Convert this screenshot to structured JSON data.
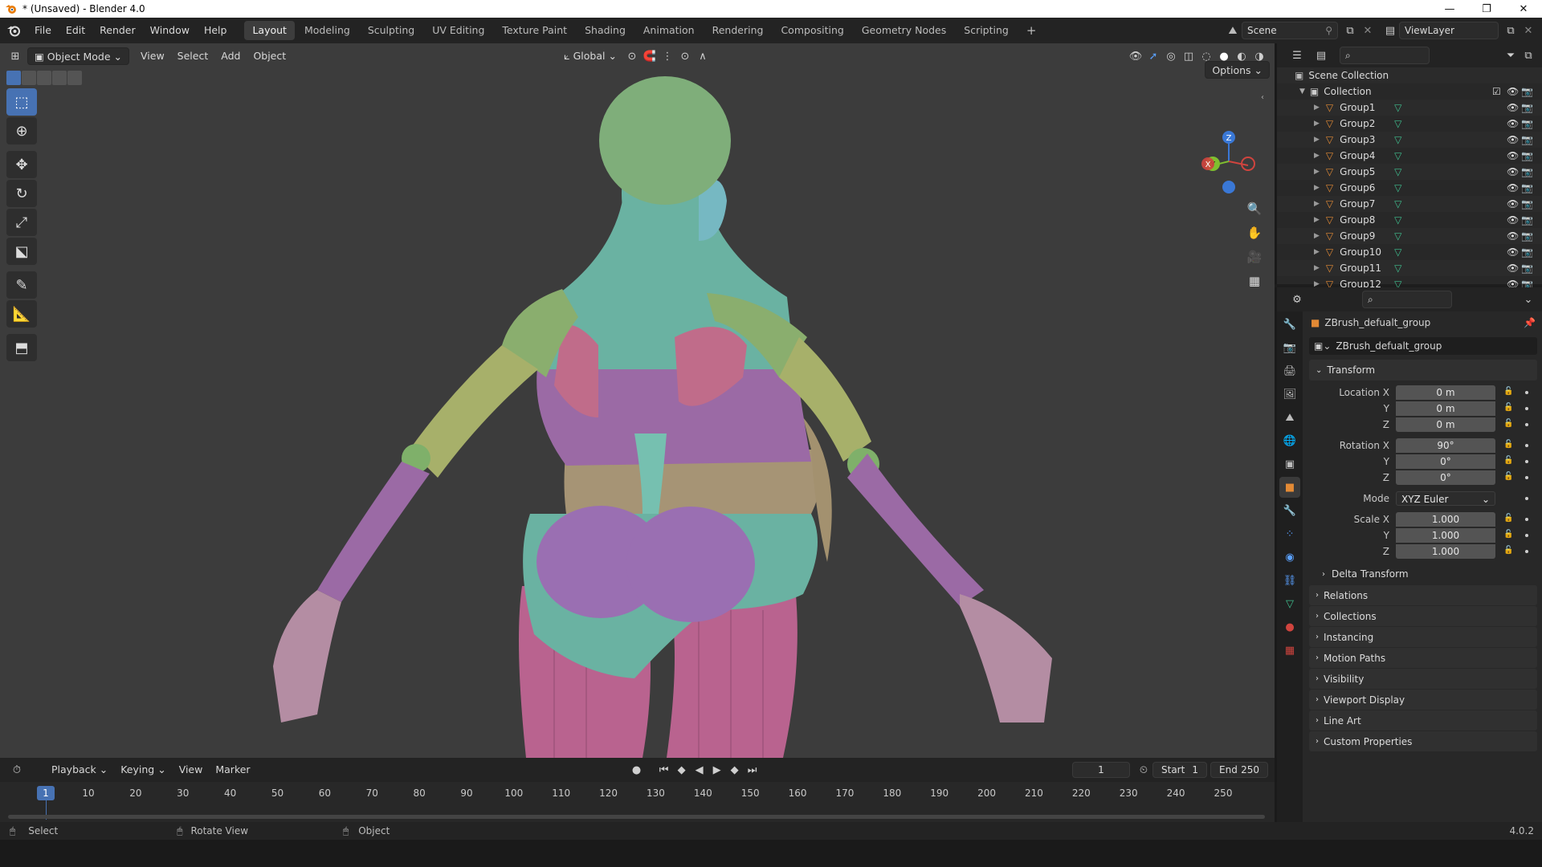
{
  "window": {
    "title": "* (Unsaved) - Blender 4.0",
    "controls": [
      "—",
      "❐",
      "✕"
    ]
  },
  "menu": {
    "items": [
      "File",
      "Edit",
      "Render",
      "Window",
      "Help"
    ],
    "workspaces": [
      "Layout",
      "Modeling",
      "Sculpting",
      "UV Editing",
      "Texture Paint",
      "Shading",
      "Animation",
      "Rendering",
      "Compositing",
      "Geometry Nodes",
      "Scripting"
    ],
    "active_workspace": "Layout",
    "add_workspace": "+",
    "scene": "Scene",
    "view_layer": "ViewLayer"
  },
  "viewport": {
    "mode": "Object Mode",
    "menus": [
      "View",
      "Select",
      "Add",
      "Object"
    ],
    "orientation": "Global",
    "options": "Options",
    "gizmo_axes": {
      "x": "X",
      "y": "Y",
      "z": "Z"
    }
  },
  "timeline": {
    "menus": [
      "Playback",
      "Keying",
      "View",
      "Marker"
    ],
    "current_frame": "1",
    "start_label": "Start",
    "start": "1",
    "end_label": "End",
    "end": "250",
    "ticks": [
      "10",
      "20",
      "30",
      "40",
      "50",
      "60",
      "70",
      "80",
      "90",
      "100",
      "110",
      "120",
      "130",
      "140",
      "150",
      "160",
      "170",
      "180",
      "190",
      "200",
      "210",
      "220",
      "230",
      "240",
      "250"
    ],
    "playhead": "1"
  },
  "statusbar": {
    "select": "Select",
    "rotate": "Rotate View",
    "object": "Object",
    "version": "4.0.2"
  },
  "outliner": {
    "scene_collection": "Scene Collection",
    "collection": "Collection",
    "groups": [
      "Group1",
      "Group2",
      "Group3",
      "Group4",
      "Group5",
      "Group6",
      "Group7",
      "Group8",
      "Group9",
      "Group10",
      "Group11",
      "Group12"
    ]
  },
  "properties": {
    "object_name": "ZBrush_defualt_group",
    "object_field": "ZBrush_defualt_group",
    "transform_label": "Transform",
    "location": {
      "label": "Location X",
      "x": "0 m",
      "y": "0 m",
      "z": "0 m"
    },
    "rotation": {
      "label": "Rotation X",
      "x": "90°",
      "y": "0°",
      "z": "0°"
    },
    "mode_label": "Mode",
    "mode": "XYZ Euler",
    "scale": {
      "label": "Scale X",
      "x": "1.000",
      "y": "1.000",
      "z": "1.000"
    },
    "axis_y": "Y",
    "axis_z": "Z",
    "delta_transform": "Delta Transform",
    "panels": [
      "Relations",
      "Collections",
      "Instancing",
      "Motion Paths",
      "Visibility",
      "Viewport Display",
      "Line Art",
      "Custom Properties"
    ]
  },
  "colors": {
    "accent": "#4772b3",
    "viewport_bg": "#3c3c3c",
    "body_teal": "#6ab2a2",
    "body_green": "#8aae6e",
    "body_purple": "#9b6aa5",
    "body_pink": "#b9638f",
    "body_tan": "#a69475",
    "object_orange": "#e38a35",
    "mesh_green": "#3fbf8f"
  }
}
